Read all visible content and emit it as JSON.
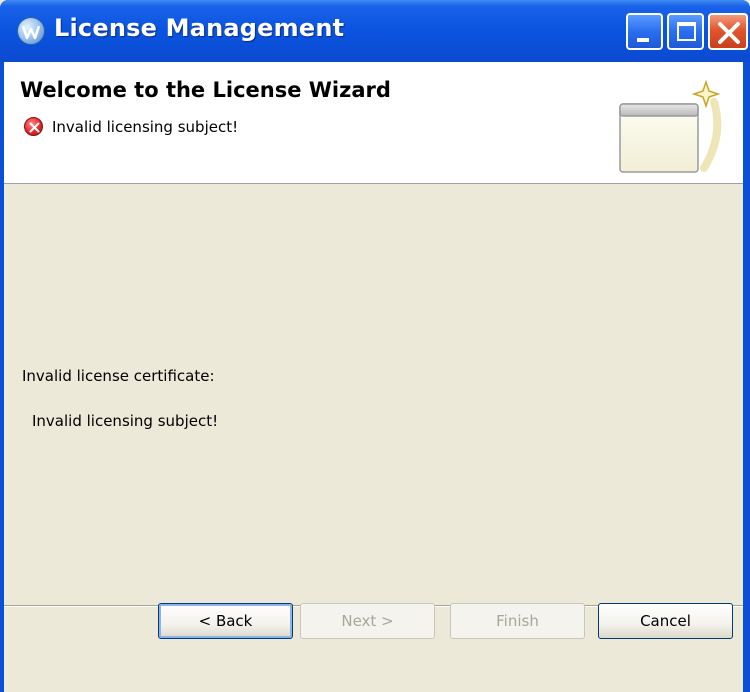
{
  "window": {
    "title": "License Management"
  },
  "header": {
    "title": "Welcome to the License Wizard",
    "error_message": "Invalid licensing subject!"
  },
  "body": {
    "certificate_label": "Invalid license certificate:",
    "certificate_detail": "Invalid licensing subject!"
  },
  "buttons": {
    "back": "< Back",
    "next": "Next >",
    "finish": "Finish",
    "cancel": "Cancel"
  },
  "button_states": {
    "back_enabled": true,
    "next_enabled": false,
    "finish_enabled": false,
    "cancel_enabled": true
  },
  "colors": {
    "titlebar": "#0a4fd8",
    "close_button": "#e2552d",
    "dialog_background": "#ece9d8",
    "error_icon": "#e02a2a"
  },
  "icons": {
    "app": "app-icon",
    "error": "error-icon",
    "banner": "wizard-banner-icon"
  }
}
